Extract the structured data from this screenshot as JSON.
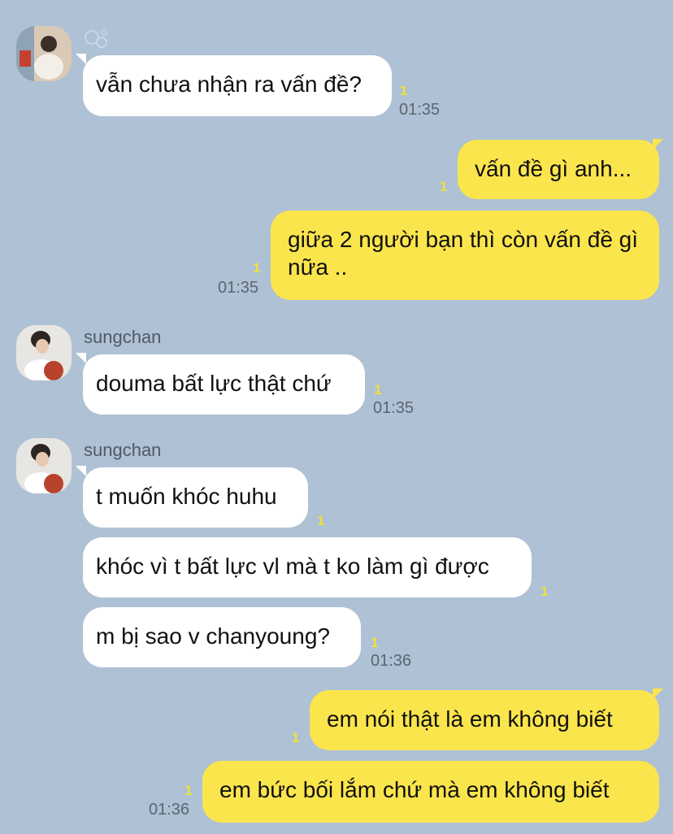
{
  "contact": {
    "name": "sungchan"
  },
  "colors": {
    "background": "#afc1d4",
    "incoming_bubble": "#ffffff",
    "outgoing_bubble": "#fbe54d",
    "unread": "#f0e13a"
  },
  "messages": [
    {
      "dir": "in",
      "text": "vẫn chưa nhận ra vấn đề?",
      "unread": "1",
      "time": "01:35"
    },
    {
      "dir": "out",
      "text": "vấn đề gì anh...",
      "unread": "1",
      "time": ""
    },
    {
      "dir": "out",
      "text": "giữa 2 người bạn thì còn vấn đề gì nữa ..",
      "unread": "1",
      "time": "01:35"
    },
    {
      "dir": "in",
      "sender": "sungchan",
      "text": "douma bất lực thật chứ",
      "unread": "1",
      "time": "01:35"
    },
    {
      "dir": "in",
      "sender": "sungchan",
      "text": "t muốn khóc huhu",
      "unread": "1",
      "time": ""
    },
    {
      "dir": "in",
      "text": "khóc vì t bất lực vl mà t ko làm gì được",
      "unread": "1",
      "time": ""
    },
    {
      "dir": "in",
      "text": "m bị sao v chanyoung?",
      "unread": "1",
      "time": "01:36"
    },
    {
      "dir": "out",
      "text": "em nói thật là em không biết",
      "unread": "1",
      "time": ""
    },
    {
      "dir": "out",
      "text": "em bức bối lắm chứ mà em không biết",
      "unread": "1",
      "time": "01:36"
    }
  ]
}
